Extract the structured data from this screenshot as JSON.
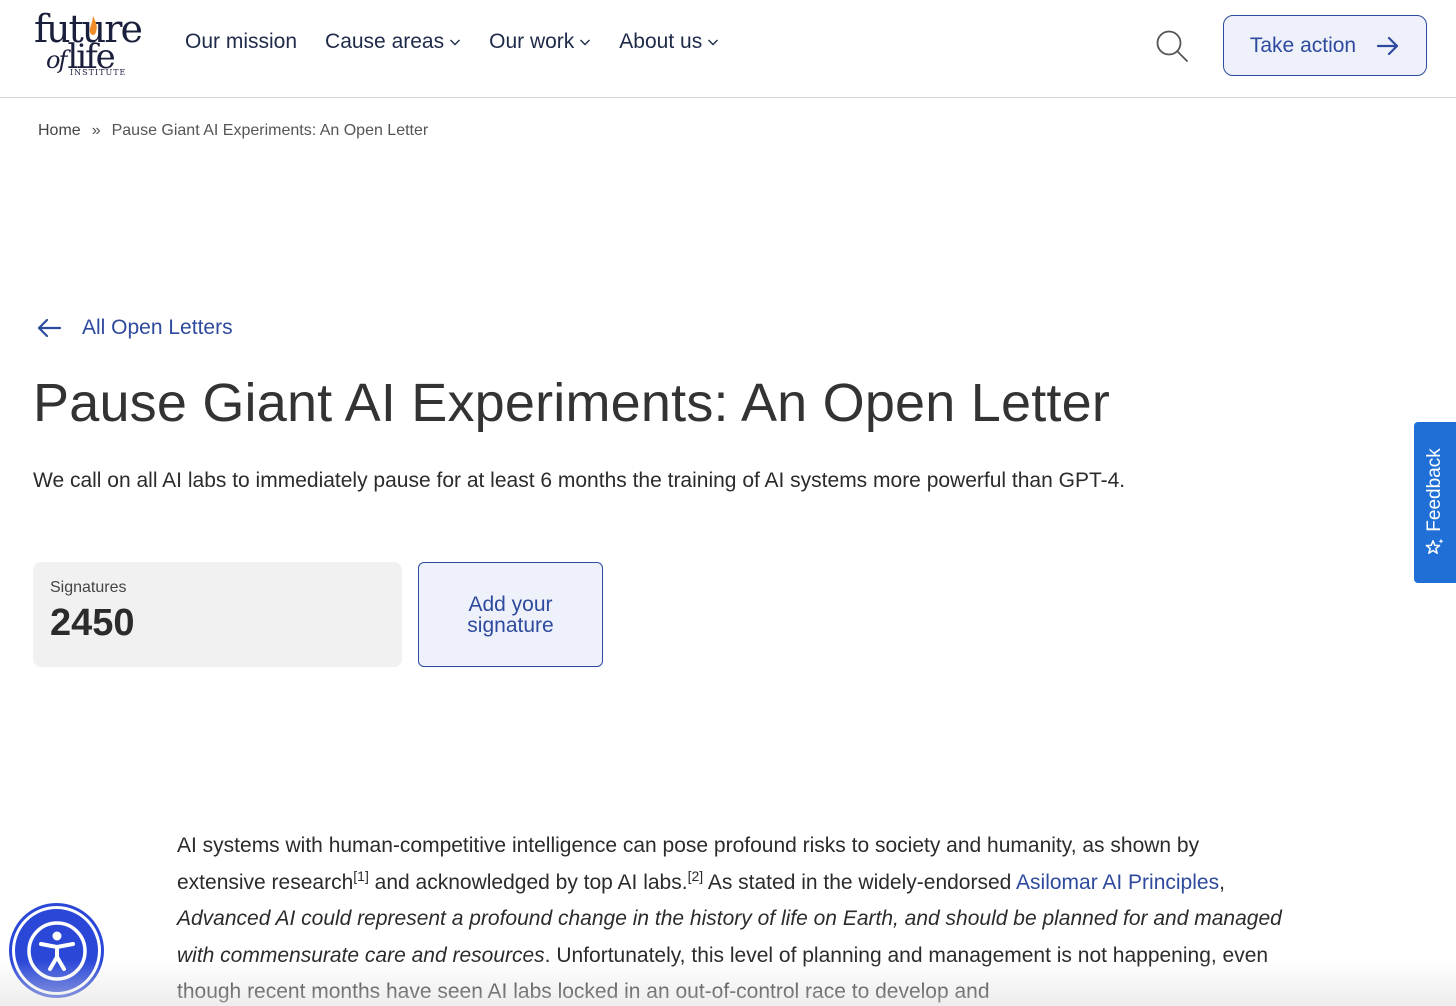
{
  "logo": {
    "line1": "future",
    "line2_of": "of",
    "line2": "life",
    "line3": "INSTITUTE"
  },
  "nav": {
    "items": [
      {
        "label": "Our mission",
        "has_dropdown": false
      },
      {
        "label": "Cause areas",
        "has_dropdown": true
      },
      {
        "label": "Our work",
        "has_dropdown": true
      },
      {
        "label": "About us",
        "has_dropdown": true
      }
    ],
    "search_icon": "search-icon",
    "cta_label": "Take action",
    "cta_icon": "arrow-right-icon"
  },
  "breadcrumb": {
    "home": "Home",
    "separator": "»",
    "current": "Pause Giant AI Experiments: An Open Letter"
  },
  "back_link": {
    "label": "All Open Letters",
    "icon": "arrow-left-icon"
  },
  "title": "Pause Giant AI Experiments: An Open Letter",
  "subtitle": "We call on all AI labs to immediately pause for at least 6 months the training of AI systems more powerful than GPT-4.",
  "signatures": {
    "label": "Signatures",
    "count": "2450"
  },
  "add_signature_label": "Add your signature",
  "body": {
    "p1_a": "AI systems with human-competitive intelligence can pose profound risks to society and humanity, as shown by extensive research",
    "ref1": "[1]",
    "p1_b": " and acknowledged by top AI labs.",
    "ref2": "[2]",
    "p1_c": " As stated in the widely-endorsed ",
    "link": "Asilomar AI Principles",
    "p1_d": ", ",
    "quote": "Advanced AI could represent a profound change in the history of life on Earth, and should be planned for and managed with commensurate care and resources",
    "p1_e": ". Unfortunately, this level of planning and management is not happening, even though recent months have seen AI labs locked in an out-of-control race to develop and"
  },
  "feedback": {
    "label": "Feedback",
    "icon": "sparkle-star-icon"
  },
  "accessibility": {
    "icon": "accessibility-person-icon"
  },
  "colors": {
    "accent": "#2e4a9e",
    "feedback_bg": "#1f6fd6",
    "accessibility_bg": "#2a47d8",
    "flame": "#f28c28"
  }
}
